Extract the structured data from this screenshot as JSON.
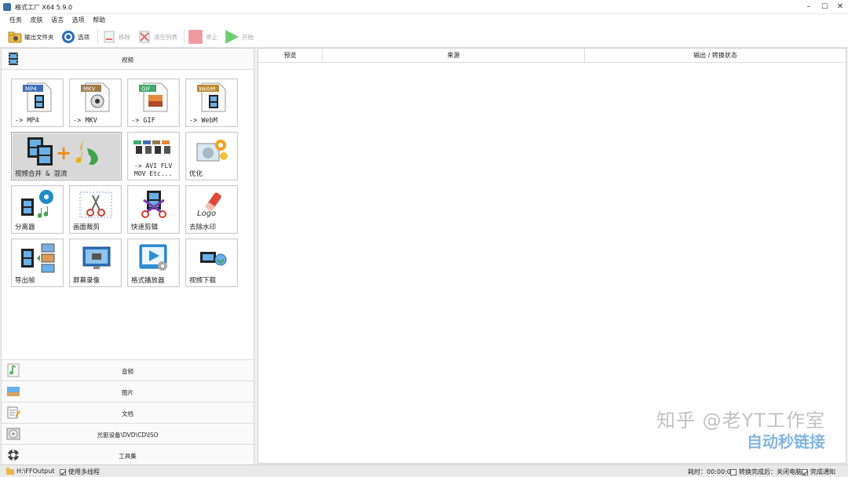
{
  "window": {
    "title": "格式工厂 X64 5.9.0",
    "minimize": "–",
    "maximize": "☐",
    "close": "✕"
  },
  "menu": [
    "任务",
    "皮肤",
    "语言",
    "选项",
    "帮助"
  ],
  "toolbar": {
    "output_folder": "输出文件夹",
    "options": "选项",
    "remove": "移除",
    "clear_list": "清空列表",
    "stop": "停止",
    "start": "开始"
  },
  "left": {
    "video_header": "视频",
    "tiles": [
      {
        "label": "-> MP4",
        "badge": "MP4",
        "badge_color": "#3f6fb8"
      },
      {
        "label": "-> MKV",
        "badge": "MKV",
        "badge_color": "#9a7b49"
      },
      {
        "label": "-> GIF",
        "badge": "GIF",
        "badge_color": "#3fa86a"
      },
      {
        "label": "-> WebM",
        "badge": "WebM",
        "badge_color": "#b9882d"
      },
      {
        "label": "视频合并 & 混流"
      },
      {
        "label": "-> AVI FLV\nMOV Etc..."
      },
      {
        "label": "优化"
      },
      {
        "label": "分离器"
      },
      {
        "label": "画面裁剪"
      },
      {
        "label": "快速剪辑"
      },
      {
        "label": "去除水印",
        "logo_text": "Logo"
      },
      {
        "label": "导出帧"
      },
      {
        "label": "屏幕录像"
      },
      {
        "label": "格式播放器"
      },
      {
        "label": "视频下载"
      }
    ],
    "categories": [
      "音频",
      "图片",
      "文档",
      "光驱设备\\DVD\\CD\\ISO",
      "工具集"
    ]
  },
  "table": {
    "columns": [
      "预览",
      "来源",
      "输出 / 转换状态"
    ]
  },
  "status": {
    "output_path": "H:\\FFOutput",
    "multithread": "使用多线程",
    "elapsed_label": "耗时：00:00:00",
    "shutdown_label": "转换完成后：关闭电脑",
    "notify_label": "完成通知"
  },
  "watermark": {
    "line1": "知乎 @老YT工作室",
    "line2": "自动秒链接"
  },
  "colors": {
    "accent": "#3a6ea5",
    "stop": "#e8898c",
    "start": "#5cc25c"
  }
}
